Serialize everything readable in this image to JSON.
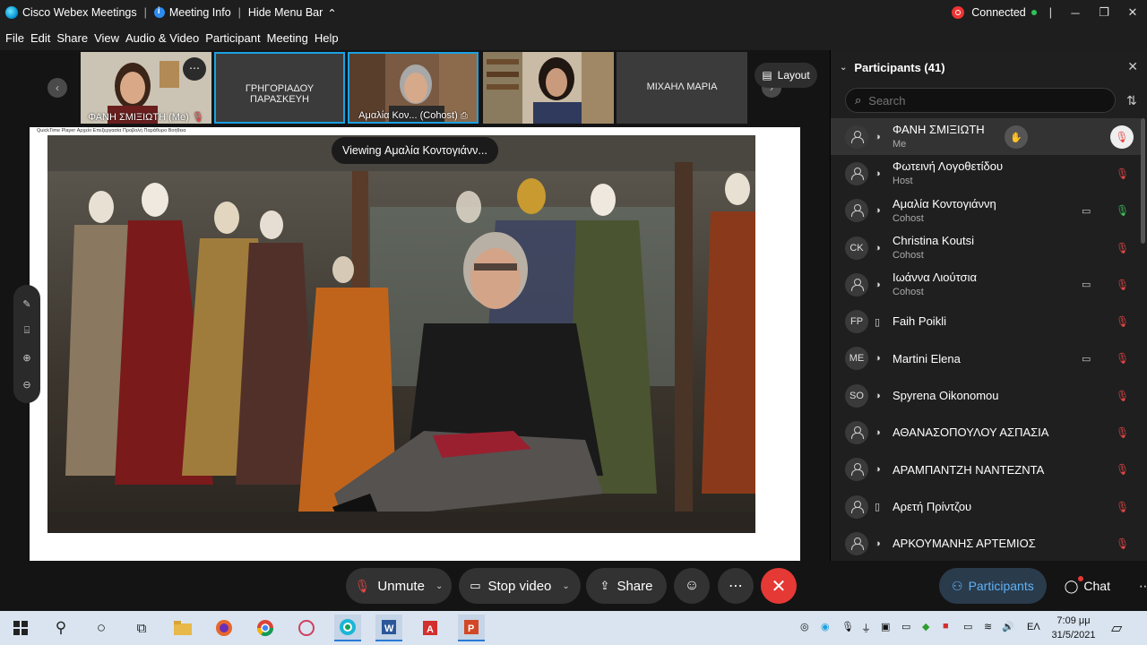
{
  "titlebar": {
    "app_name": "Cisco Webex Meetings",
    "meeting_info": "Meeting Info",
    "hide_menu": "Hide Menu Bar",
    "connection_status": "Connected"
  },
  "menu": [
    "File",
    "Edit",
    "Share",
    "View",
    "Audio & Video",
    "Participant",
    "Meeting",
    "Help"
  ],
  "thumbnails": [
    {
      "name": "ΦΑΝΗ ΣΜΙΞΙΩΤΗ  (Me)",
      "type": "video"
    },
    {
      "name": "ΓΡΗΓΟΡΙΑΔΟΥ ΠΑΡΑΣΚΕΥΗ",
      "type": "name"
    },
    {
      "name": "Αμαλία Κον...  (Cohost)",
      "type": "video"
    },
    {
      "name": "",
      "type": "video"
    },
    {
      "name": "ΜΙΧΑΗΛ ΜΑΡΙΑ",
      "type": "name"
    }
  ],
  "layout_label": "Layout",
  "share": {
    "viewing_label": "Viewing Αμαλία Κοντογιάνν...",
    "qt_menu": "QuickTime Player   Αρχείο   Επεξεργασία   Προβολή   Παράθυρο   Βοήθεια"
  },
  "participants_panel": {
    "title": "Participants (41)",
    "search_placeholder": "Search",
    "participants": [
      {
        "name": "ΦΑΝΗ ΣΜΙΞΙΩΤΗ",
        "role": "Me",
        "avatar": "",
        "device": "headset",
        "camera": false,
        "mic": "muted"
      },
      {
        "name": "Φωτεινή Λογοθετίδου",
        "role": "Host",
        "avatar": "",
        "device": "headset",
        "camera": false,
        "mic": "muted"
      },
      {
        "name": "Αμαλία Κοντογιάννη",
        "role": "Cohost",
        "avatar": "",
        "device": "headset",
        "camera": true,
        "mic": "on"
      },
      {
        "name": "Christina Koutsi",
        "role": "Cohost",
        "avatar": "CK",
        "device": "headset",
        "camera": false,
        "mic": "muted"
      },
      {
        "name": "Ιωάννα Λιούτσια",
        "role": "Cohost",
        "avatar": "",
        "device": "headset",
        "camera": true,
        "mic": "muted"
      },
      {
        "name": "Faih Poikli",
        "role": "",
        "avatar": "FP",
        "device": "phone",
        "camera": false,
        "mic": "muted"
      },
      {
        "name": "Martini Elena",
        "role": "",
        "avatar": "ME",
        "device": "headset",
        "camera": true,
        "mic": "muted"
      },
      {
        "name": "Spyrena Oikonomou",
        "role": "",
        "avatar": "SO",
        "device": "headset",
        "camera": false,
        "mic": "muted"
      },
      {
        "name": "ΑΘΑΝΑΣΟΠΟΥΛΟΥ ΑΣΠΑΣΙΑ",
        "role": "",
        "avatar": "",
        "device": "headset",
        "camera": false,
        "mic": "muted"
      },
      {
        "name": "ΑΡΑΜΠΑΝΤΖΗ ΝΑΝΤΕΖΝΤΑ",
        "role": "",
        "avatar": "",
        "device": "headset",
        "camera": false,
        "mic": "muted"
      },
      {
        "name": "Αρετή Πρίντζου",
        "role": "",
        "avatar": "",
        "device": "phone",
        "camera": false,
        "mic": "muted"
      },
      {
        "name": "ΑΡΚΟΥΜΑΝΗΣ ΑΡΤΕΜΙΟΣ",
        "role": "",
        "avatar": "",
        "device": "headset",
        "camera": false,
        "mic": "muted"
      }
    ]
  },
  "controls": {
    "unmute": "Unmute",
    "stop_video": "Stop video",
    "share": "Share",
    "participants": "Participants",
    "chat": "Chat"
  },
  "taskbar": {
    "language": "ΕΛ",
    "time": "7:09 μμ",
    "date": "31/5/2021"
  }
}
